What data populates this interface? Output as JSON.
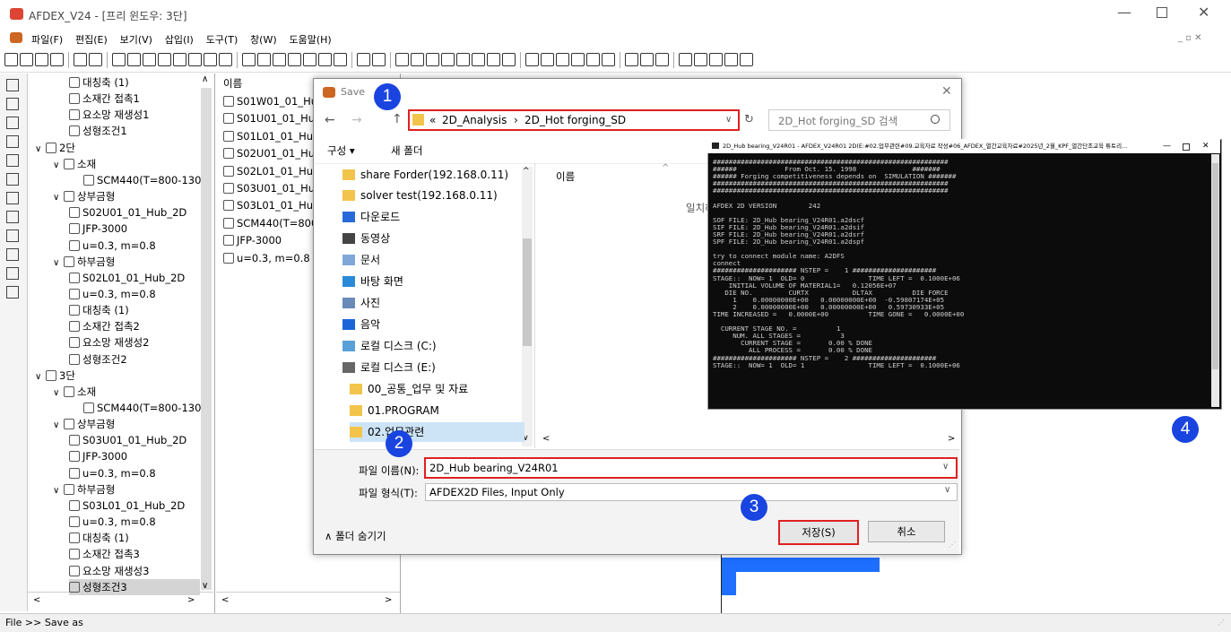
{
  "app": {
    "title": "AFDEX_V24 - [프리 윈도우: 3단]",
    "menus": [
      "파일(F)",
      "편집(E)",
      "보기(V)",
      "삽입(I)",
      "도구(T)",
      "창(W)",
      "도움말(H)"
    ]
  },
  "tree_rows": [
    {
      "label": "대칭축 (1)",
      "indent": 2
    },
    {
      "label": "소재간 접촉1",
      "indent": 2
    },
    {
      "label": "요소망 재생성1",
      "indent": 2
    },
    {
      "label": "성형조건1",
      "indent": 2
    },
    {
      "label": "2단",
      "indent": 0,
      "expand": "∨"
    },
    {
      "label": "소재",
      "indent": 1,
      "expand": "∨"
    },
    {
      "label": "SCM440(T=800-130",
      "indent": 3
    },
    {
      "label": "상부금형",
      "indent": 1,
      "expand": "∨"
    },
    {
      "label": "S02U01_01_Hub_2D",
      "indent": 2
    },
    {
      "label": "JFP-3000",
      "indent": 2
    },
    {
      "label": "u=0.3, m=0.8",
      "indent": 2
    },
    {
      "label": "하부금형",
      "indent": 1,
      "expand": "∨"
    },
    {
      "label": "S02L01_01_Hub_2D",
      "indent": 2
    },
    {
      "label": "u=0.3, m=0.8",
      "indent": 2
    },
    {
      "label": "대칭축 (1)",
      "indent": 2
    },
    {
      "label": "소재간 접촉2",
      "indent": 2
    },
    {
      "label": "요소망 재생성2",
      "indent": 2
    },
    {
      "label": "성형조건2",
      "indent": 2
    },
    {
      "label": "3단",
      "indent": 0,
      "expand": "∨"
    },
    {
      "label": "소재",
      "indent": 1,
      "expand": "∨"
    },
    {
      "label": "SCM440(T=800-130",
      "indent": 3
    },
    {
      "label": "상부금형",
      "indent": 1,
      "expand": "∨"
    },
    {
      "label": "S03U01_01_Hub_2D",
      "indent": 2
    },
    {
      "label": "JFP-3000",
      "indent": 2
    },
    {
      "label": "u=0.3, m=0.8",
      "indent": 2
    },
    {
      "label": "하부금형",
      "indent": 1,
      "expand": "∨"
    },
    {
      "label": "S03L01_01_Hub_2D",
      "indent": 2
    },
    {
      "label": "u=0.3, m=0.8",
      "indent": 2
    },
    {
      "label": "대칭축 (1)",
      "indent": 2
    },
    {
      "label": "소재간 접촉3",
      "indent": 2
    },
    {
      "label": "요소망 재생성3",
      "indent": 2
    },
    {
      "label": "성형조건3",
      "indent": 2,
      "selected": true
    }
  ],
  "list": {
    "header": "이름",
    "items": [
      "S01W01_01_Hu",
      "S01U01_01_Hub",
      "S01L01_01_Hub",
      "S02U01_01_Hub",
      "S02L01_01_Hub",
      "S03U01_01_Hub",
      "S03L01_01_Hub",
      "SCM440(T=800",
      "JFP-3000",
      "u=0.3, m=0.8"
    ]
  },
  "dialog": {
    "title": "Save",
    "address": {
      "prefix": "«",
      "crumb1": "2D_Analysis",
      "sep": "›",
      "crumb2": "2D_Hot forging_SD"
    },
    "search_placeholder": "2D_Hot forging_SD 검색",
    "organize": "구성 ▾",
    "new_folder": "새 폴더",
    "nav_items": [
      "share Forder(192.168.0.11)",
      "solver test(192.168.0.11)",
      "다운로드",
      "동영상",
      "문서",
      "바탕 화면",
      "사진",
      "음악",
      "로컬 디스크 (C:)",
      "로컬 디스크 (E:)",
      "00_공통_업무 및 자료",
      "01.PROGRAM",
      "02.업무관련"
    ],
    "column_name": "이름",
    "empty_text": "일치하",
    "filename_label": "파일 이름(N):",
    "filename_value": "2D_Hub bearing_V24R01",
    "filetype_label": "파일 형식(T):",
    "filetype_value": "AFDEX2D Files, Input Only",
    "hide_folders": "∧  폴더 숨기기",
    "save_button": "저장(S)",
    "cancel_button": "취소"
  },
  "badges": [
    "1",
    "2",
    "3",
    "4"
  ],
  "console": {
    "title": "2D_Hub bearing_V24R01 - AFDEX_V24R01 2D(E:#02.업무관련#09.교육자료 작성#06_AFDEX_열간교육자료#2025년_2월_KPF_열간단조교육 튜토리...",
    "lines": [
      "###########################################################",
      "######            From Oct. 15. 1998              #######",
      "###### Forging competitiveness depends on  SIMULATION #######",
      "###########################################################",
      "###########################################################",
      "",
      "AFDEX 2D VERSION        242",
      "",
      "SOF FILE: 2D_Hub bearing_V24R01.a2dscf",
      "SIF FILE: 2D_Hub bearing_V24R01.a2dsif",
      "SRF FILE: 2D_Hub bearing_V24R01.a2dsrf",
      "SPF FILE: 2D_Hub bearing_V24R01.a2dspf",
      "",
      "try to connect module name: A2DFS",
      "connect",
      "##################### NSTEP =    1 #####################",
      "STAGE::  NOW= 1  OLD= 0                TIME LEFT =  0.1000E+06",
      "    INITIAL VOLUME OF MATERIAL1=   0.12056E+07",
      "   DIE NO.         CURTX           DLTAX          DIE FORCE",
      "     1    0.00000000E+00   0.00000000E+00  -0.59807174E+05",
      "     2    0.00000000E+00   0.00000000E+00   0.59730933E+05",
      "TIME INCREASED =   0.0000E+00          TIME GONE =   0.0000E+00",
      "",
      "  CURRENT STAGE NO. =          1",
      "     NUM. ALL STAGES =          3",
      "       CURRENT STAGE =       0.00 % DONE",
      "         ALL PROCESS =       0.00 % DONE",
      "##################### NSTEP =    2 #####################",
      "STAGE::  NOW= 1  OLD= 1                TIME LEFT =  0.1000E+06"
    ]
  },
  "status": "File >> Save as",
  "colors": {
    "highlight": "#e02020",
    "badge": "#1a44e0",
    "blue_shape": "#1e6fff",
    "console_bg": "#0c0c0c",
    "folder": "#f3c44b"
  }
}
